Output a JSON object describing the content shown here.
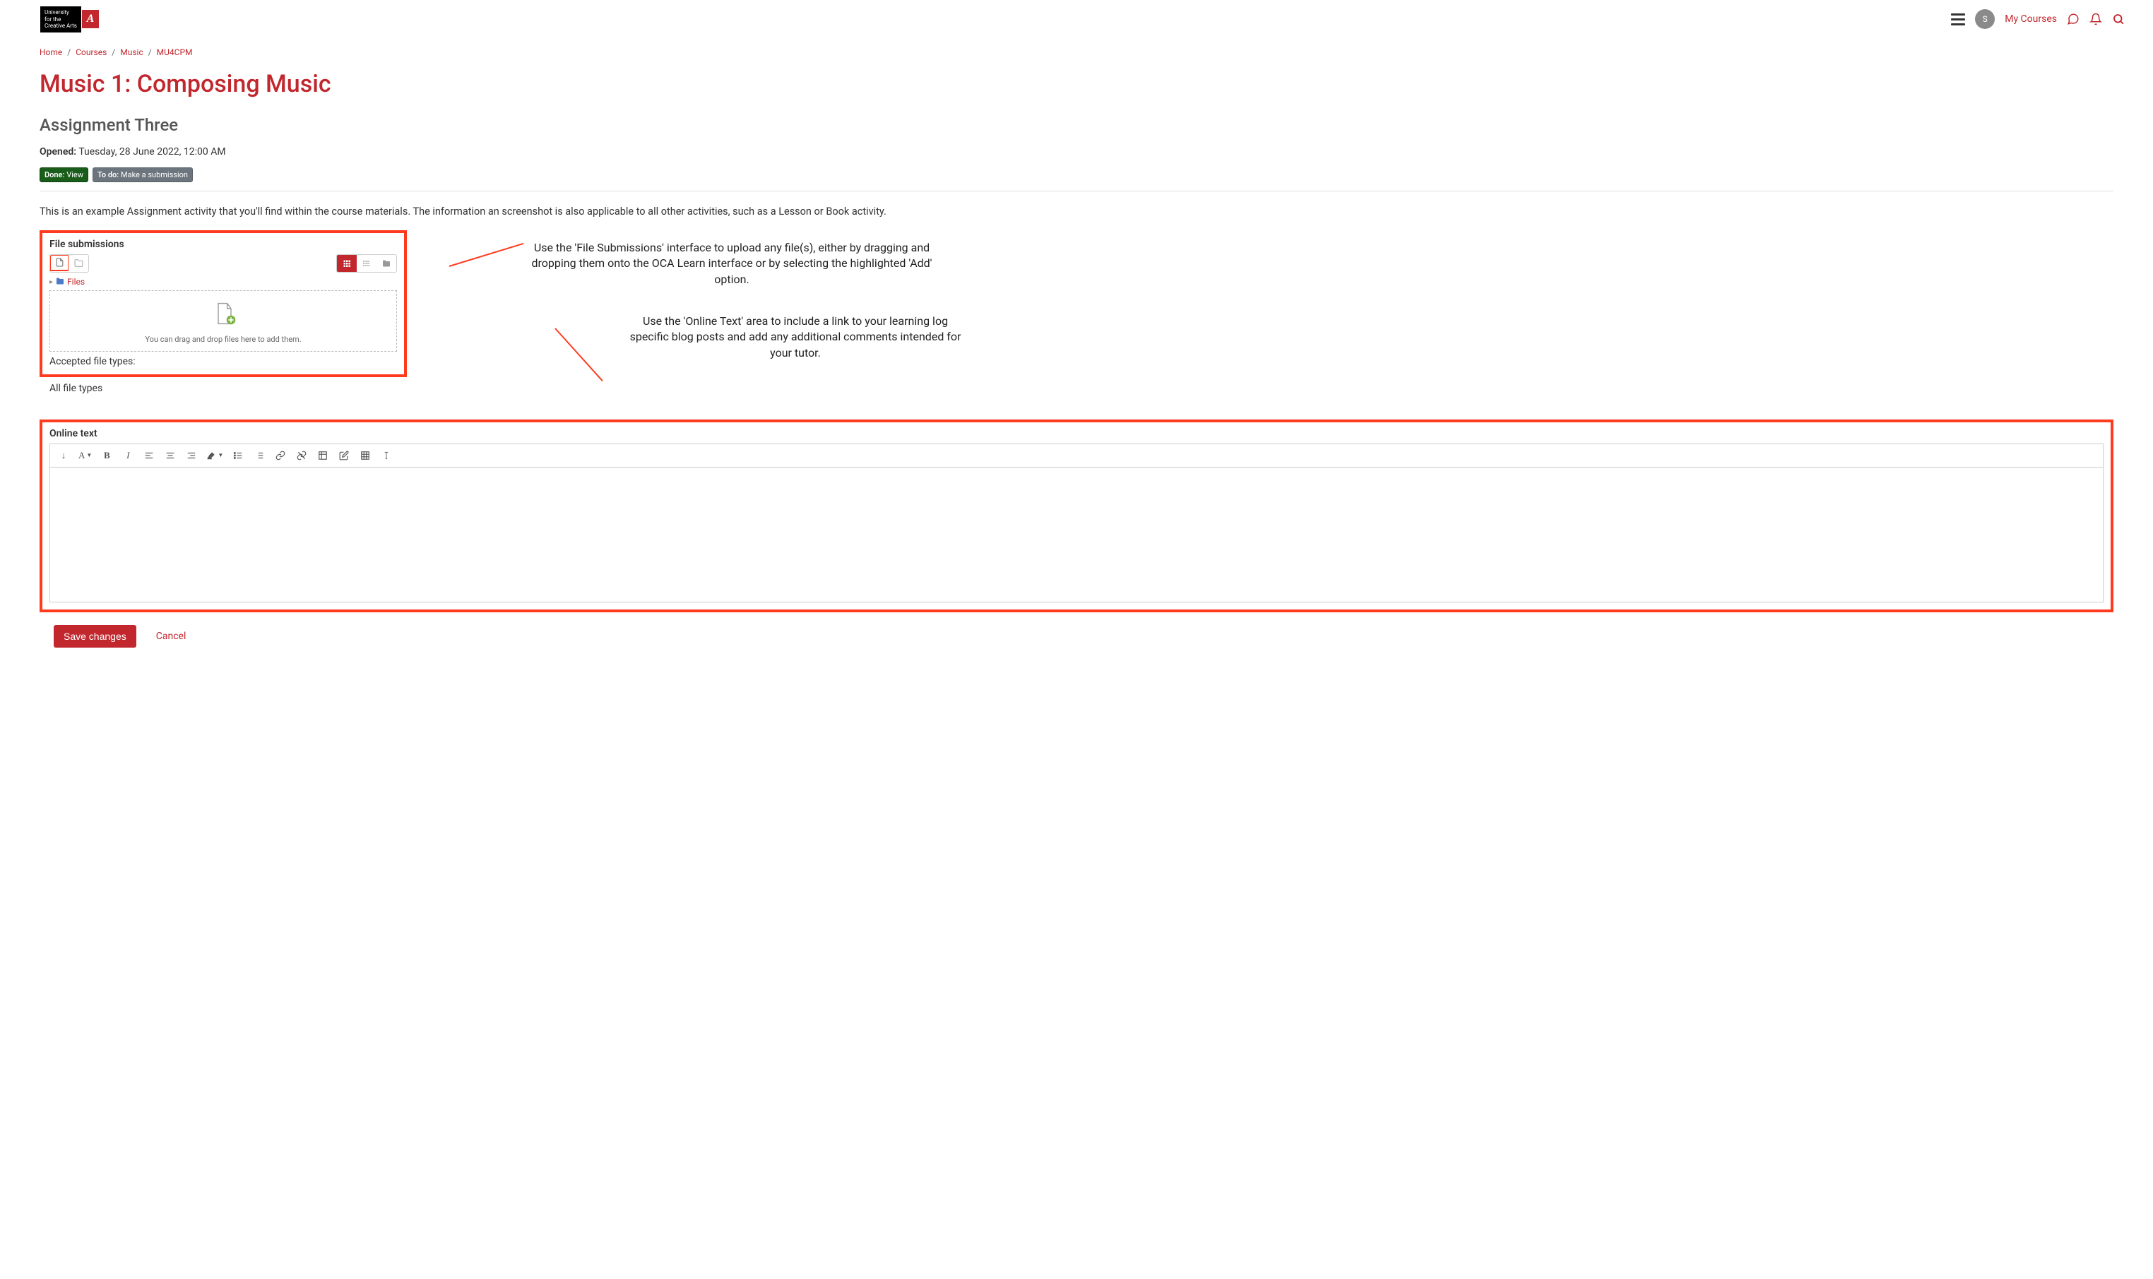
{
  "header": {
    "logo_text_1": "University",
    "logo_text_2": "for the",
    "logo_text_3": "Creative Arts",
    "logo_badge": "A",
    "my_courses": "My Courses",
    "avatar_initial": "S"
  },
  "breadcrumb": {
    "items": [
      "Home",
      "Courses",
      "Music",
      "MU4CPM"
    ]
  },
  "page": {
    "title": "Music 1: Composing Music",
    "assignment_title": "Assignment Three",
    "opened_label": "Opened:",
    "opened_value": "Tuesday, 28 June 2022, 12:00 AM"
  },
  "badges": {
    "done_label": "Done:",
    "done_value": "View",
    "todo_label": "To do:",
    "todo_value": "Make a submission"
  },
  "description": "This is an example Assignment activity that you'll find within the course materials. The information an screenshot is also applicable to all other activities, such as a Lesson or Book activity.",
  "file_submissions": {
    "label": "File submissions",
    "files_link": "Files",
    "drop_text": "You can drag and drop files here to add them.",
    "accepted_label": "Accepted file types:",
    "all_types": "All file types"
  },
  "annotations": {
    "file_note": "Use the 'File Submissions' interface to upload any file(s), either by dragging and dropping them onto the OCA Learn interface or by selecting the highlighted 'Add' option.",
    "online_note": "Use the 'Online Text' area to include a link to your learning log specific blog posts and add any additional comments intended for your tutor."
  },
  "online_text": {
    "label": "Online text"
  },
  "buttons": {
    "save": "Save changes",
    "cancel": "Cancel"
  }
}
